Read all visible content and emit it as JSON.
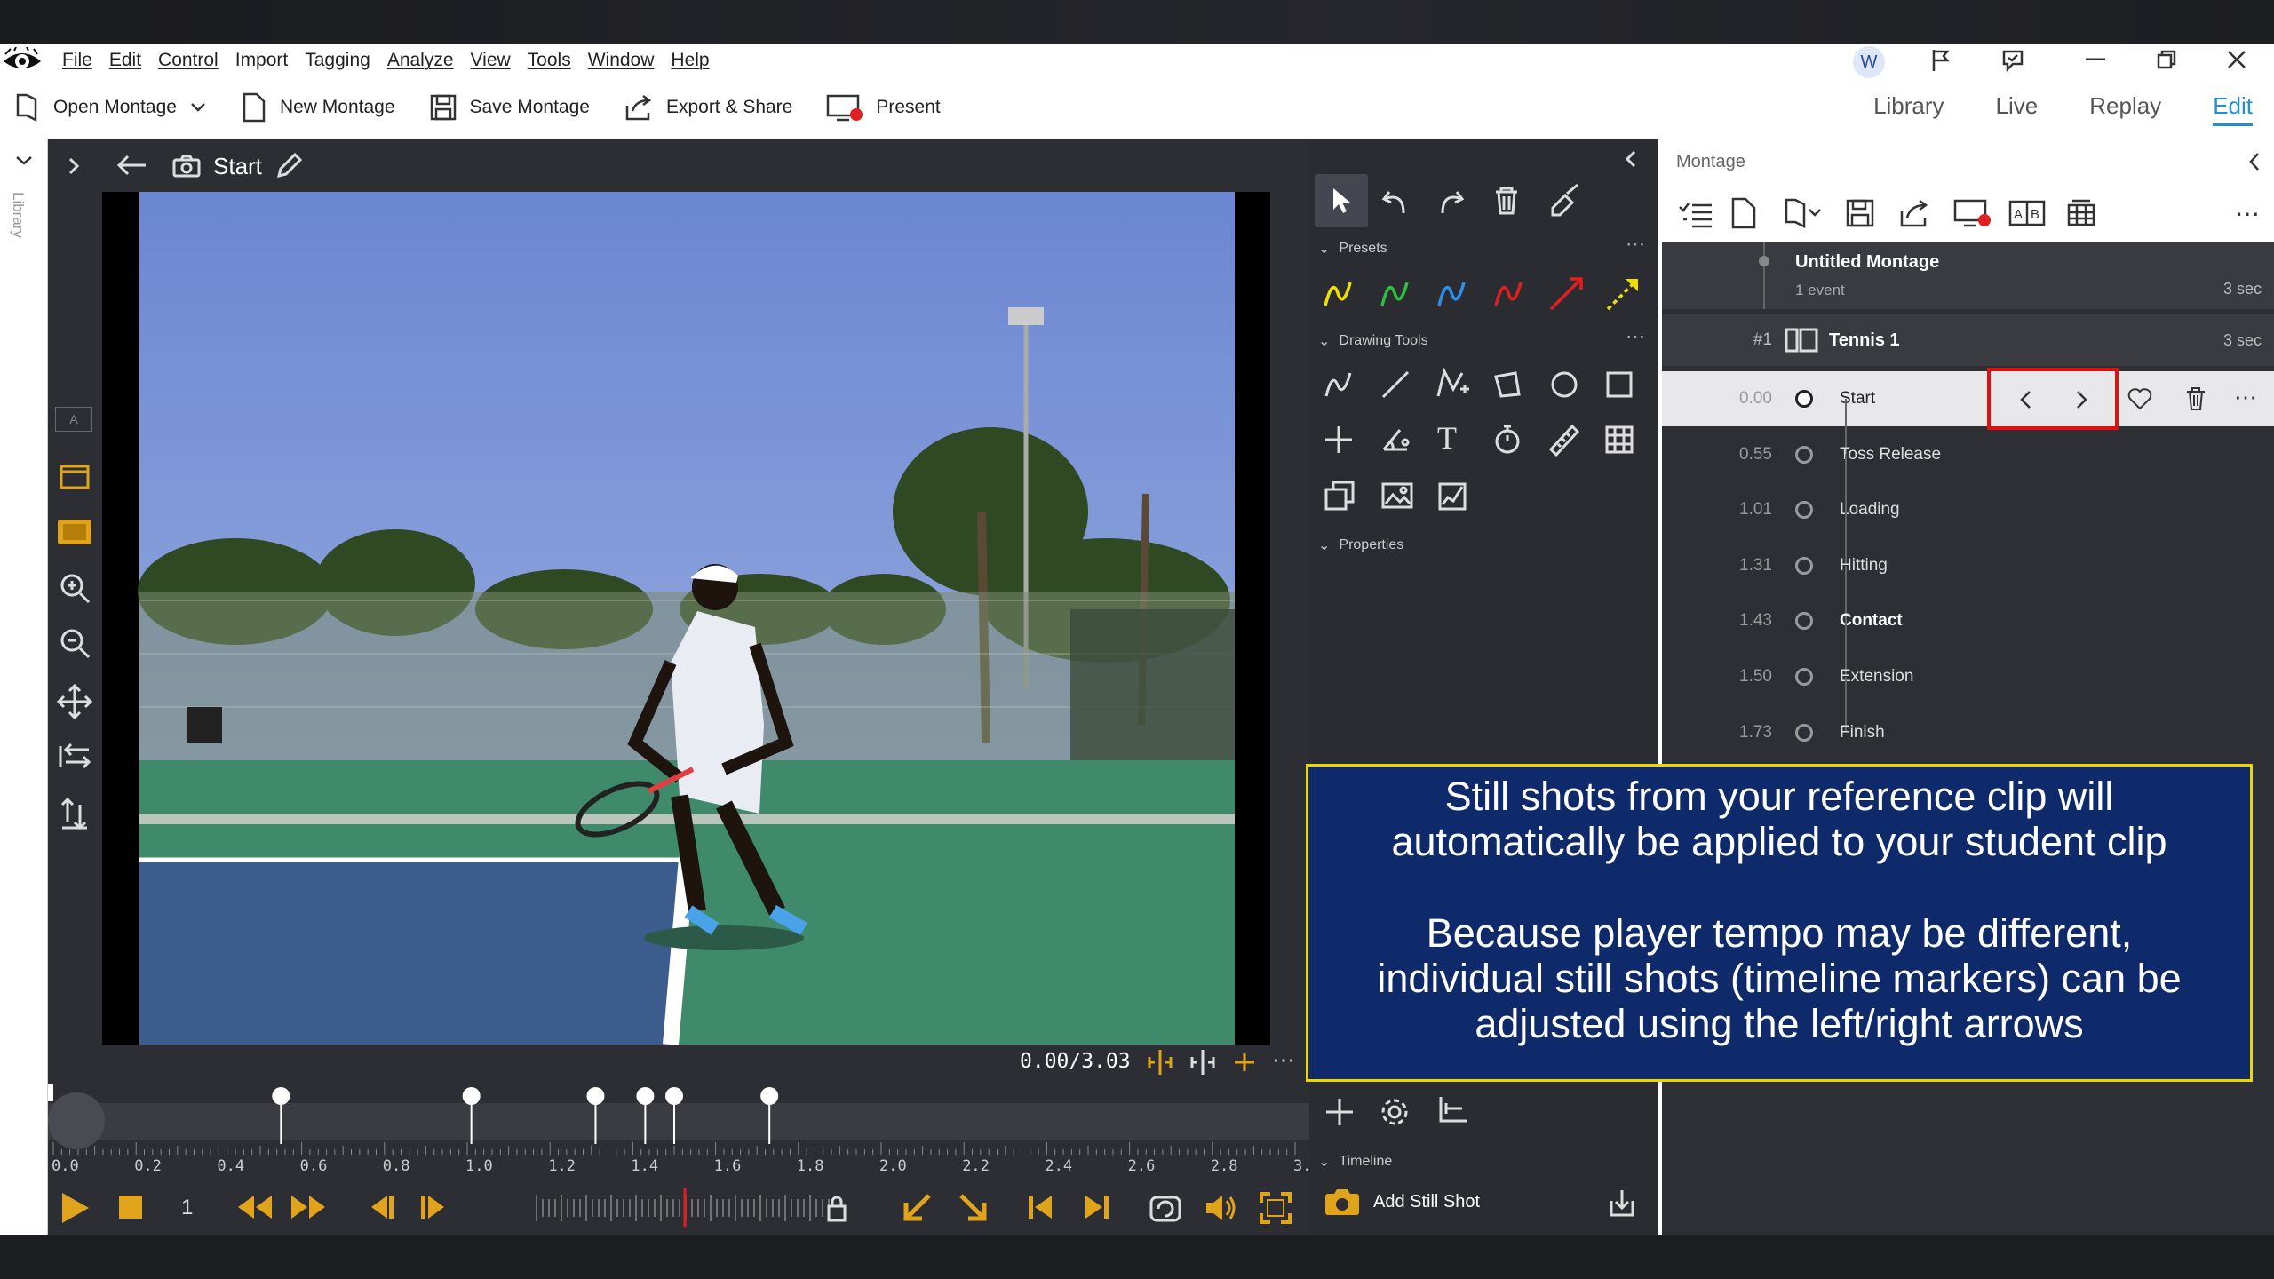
{
  "menu": {
    "items": [
      "File",
      "Edit",
      "Control",
      "Import",
      "Tagging",
      "Analyze",
      "View",
      "Tools",
      "Window",
      "Help"
    ]
  },
  "user_avatar": "W",
  "toolbar": {
    "open_montage": "Open Montage",
    "new_montage": "New Montage",
    "save_montage": "Save Montage",
    "export_share": "Export & Share",
    "present": "Present"
  },
  "view_tabs": [
    "Library",
    "Live",
    "Replay",
    "Edit"
  ],
  "active_view": "Edit",
  "left_rail": {
    "library_label": "Library"
  },
  "canvas_bar": {
    "title": "Start"
  },
  "tools": {
    "presets_label": "Presets",
    "drawing_tools_label": "Drawing Tools",
    "properties_label": "Properties",
    "timeline_label": "Timeline",
    "preset_colors": [
      "#f0e000",
      "#2fbf3f",
      "#2f8ee8",
      "#e02020",
      "#e02020",
      "#f0e000"
    ]
  },
  "video": {
    "time_readout": "0.00/3.03"
  },
  "montage": {
    "panel_title": "Montage",
    "title": "Untitled Montage",
    "subtitle": "1 event",
    "total_duration": "3 sec",
    "clip": {
      "index": "#1",
      "name": "Tennis 1",
      "duration": "3 sec"
    },
    "markers": [
      {
        "time": "0.00",
        "name": "Start",
        "selected": true,
        "bold": false
      },
      {
        "time": "0.55",
        "name": "Toss Release",
        "selected": false,
        "bold": false
      },
      {
        "time": "1.01",
        "name": "Loading",
        "selected": false,
        "bold": false
      },
      {
        "time": "1.31",
        "name": "Hitting",
        "selected": false,
        "bold": false
      },
      {
        "time": "1.43",
        "name": "Contact",
        "selected": false,
        "bold": true
      },
      {
        "time": "1.50",
        "name": "Extension",
        "selected": false,
        "bold": false
      },
      {
        "time": "1.73",
        "name": "Finish",
        "selected": false,
        "bold": false
      }
    ]
  },
  "timeline": {
    "ticks": [
      "0.0",
      "0.2",
      "0.4",
      "0.6",
      "0.8",
      "1.0",
      "1.2",
      "1.4",
      "1.6",
      "1.8",
      "2.0",
      "2.2",
      "2.4",
      "2.6",
      "2.8",
      "3."
    ],
    "marker_times": [
      0.55,
      1.01,
      1.31,
      1.43,
      1.5,
      1.73
    ],
    "frame_step": "1",
    "add_still_shot": "Add Still Shot"
  },
  "callout": {
    "line1": "Still shots from your reference clip will",
    "line2": "automatically be applied to your student clip",
    "line3": "Because player tempo may be different,",
    "line4": "individual still shots (timeline markers) can be",
    "line5": "adjusted using the left/right arrows"
  }
}
